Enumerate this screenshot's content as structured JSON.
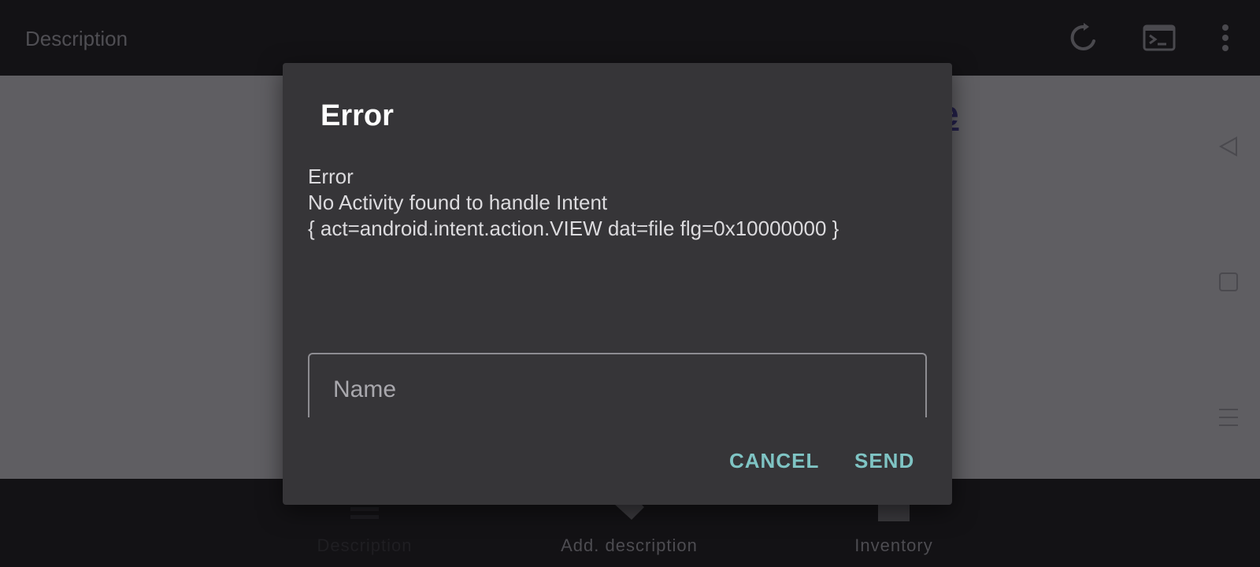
{
  "topbar": {
    "title": "Description",
    "icons": [
      "refresh-icon",
      "terminal-icon",
      "more-vert-icon"
    ]
  },
  "content": {
    "link_fragment": "e"
  },
  "navrail": {
    "icons": [
      "back-icon",
      "home-icon",
      "menu-icon"
    ]
  },
  "bottombar": {
    "tabs": [
      {
        "label": "Description",
        "icon": "list-icon"
      },
      {
        "label": "Add. description",
        "icon": "tag-icon"
      },
      {
        "label": "Inventory",
        "icon": "box-icon"
      }
    ]
  },
  "dialog": {
    "title": "Error",
    "message": "Error\nNo Activity found to handle Intent\n{ act=android.intent.action.VIEW dat=file flg=0x10000000 }",
    "name_placeholder": "Name",
    "cancel_label": "CANCEL",
    "send_label": "SEND"
  },
  "colors": {
    "accent": "#7fc4c4",
    "dialog_bg": "#363538",
    "bar_bg": "#131215"
  }
}
